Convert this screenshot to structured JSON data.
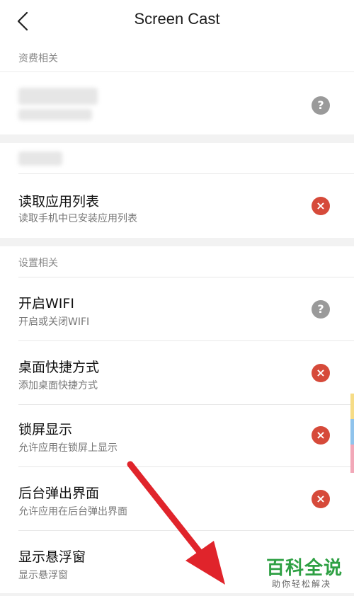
{
  "header": {
    "title": "Screen Cast"
  },
  "sections": {
    "billing": {
      "label": "资费相关"
    },
    "privacy": {
      "label": "隐私相关"
    },
    "settings": {
      "label": "设置相关"
    }
  },
  "rows": {
    "blurred_item": {
      "status": "?"
    },
    "read_apps": {
      "title": "读取应用列表",
      "subtitle": "读取手机中已安装应用列表",
      "status": "×"
    },
    "wifi": {
      "title": "开启WIFI",
      "subtitle": "开启或关闭WIFI",
      "status": "?"
    },
    "shortcut": {
      "title": "桌面快捷方式",
      "subtitle": "添加桌面快捷方式",
      "status": "×"
    },
    "lockscreen": {
      "title": "锁屏显示",
      "subtitle": "允许应用在锁屏上显示",
      "status": "×"
    },
    "background_popup": {
      "title": "后台弹出界面",
      "subtitle": "允许应用在后台弹出界面",
      "status": "×"
    },
    "floating_window": {
      "title": "显示悬浮窗",
      "subtitle": "显示悬浮窗"
    }
  },
  "watermark": {
    "title": "百科全说",
    "subtitle": "助你轻松解决"
  },
  "colors": {
    "deny": "#d64a3a",
    "ask": "#9a9a9a",
    "divider": "#e8e8e8",
    "arrow": "#e0242b",
    "watermark": "#2ea043"
  },
  "icons": {
    "back": "chevron-left-icon",
    "deny": "close-circle-icon",
    "ask": "question-circle-icon"
  }
}
